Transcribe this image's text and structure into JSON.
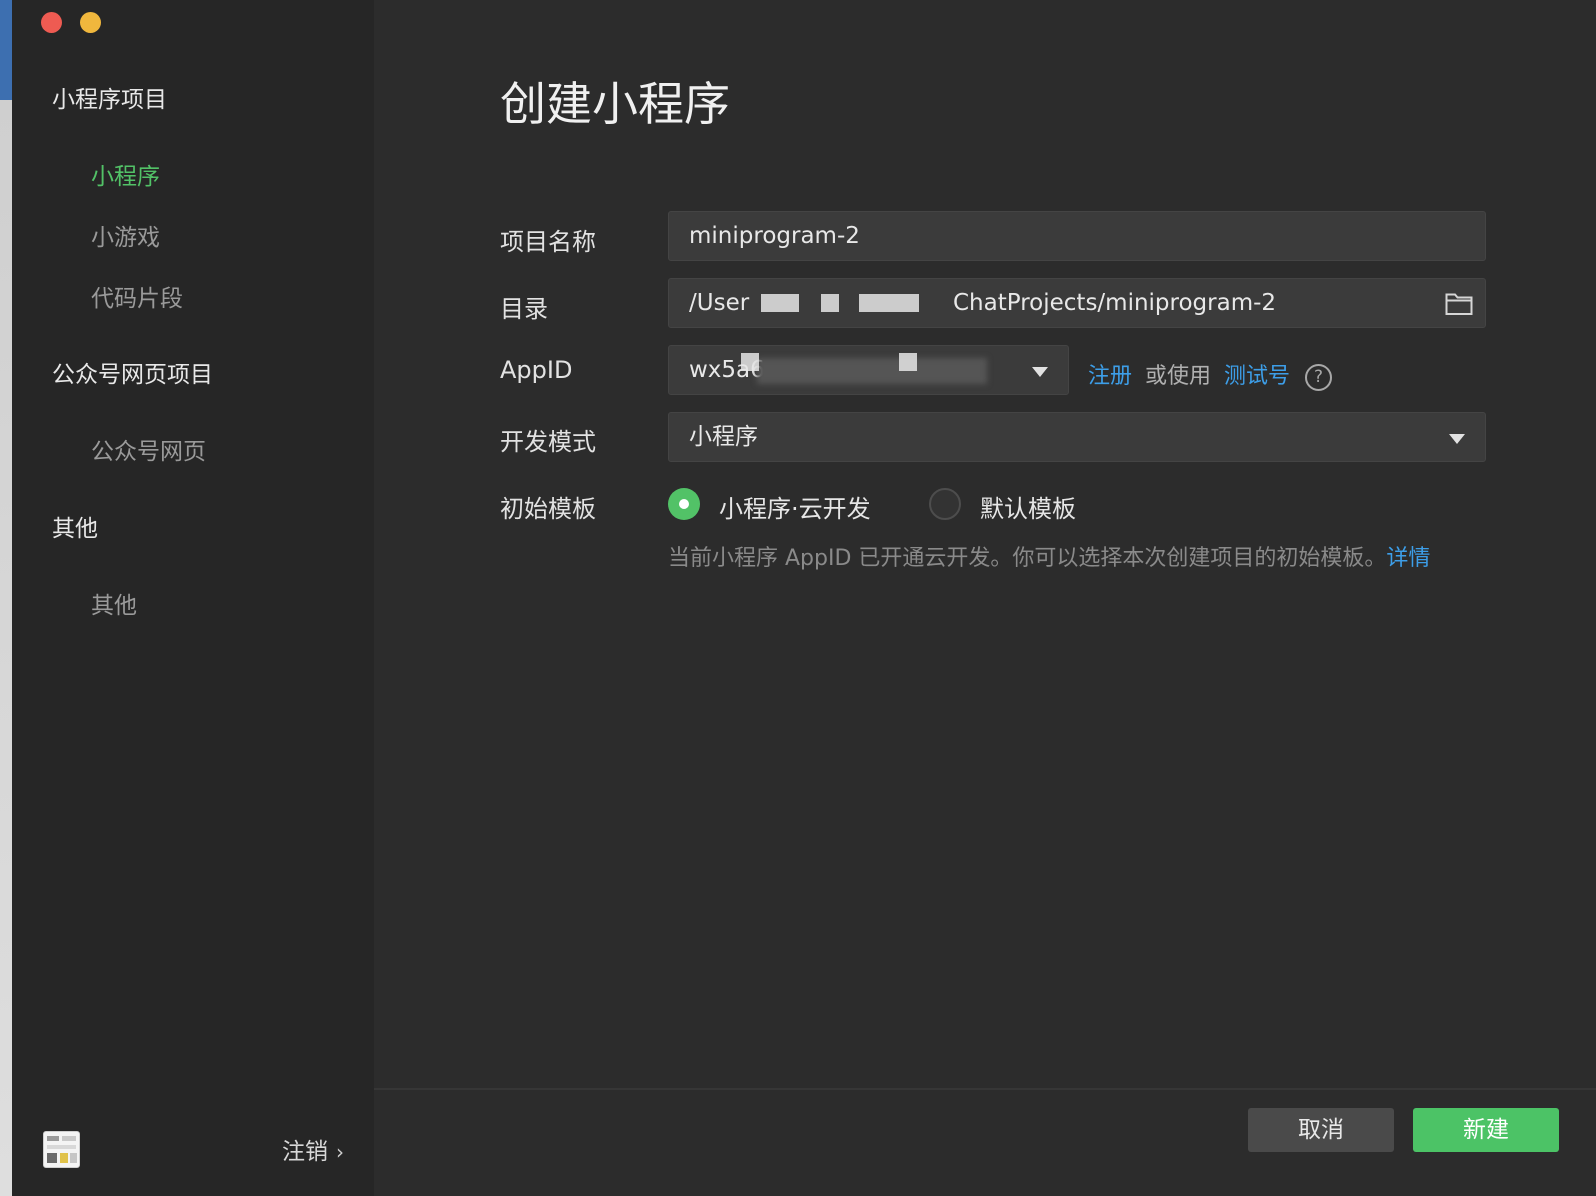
{
  "sidebar": {
    "groups": [
      {
        "title": "小程序项目",
        "items": [
          "小程序",
          "小游戏",
          "代码片段"
        ]
      },
      {
        "title": "公众号网页项目",
        "items": [
          "公众号网页"
        ]
      },
      {
        "title": "其他",
        "items": [
          "其他"
        ]
      }
    ],
    "active_item": "小程序",
    "logout_label": "注销",
    "logout_chevron": "›"
  },
  "main": {
    "title": "创建小程序",
    "fields": {
      "project_name_label": "项目名称",
      "project_name_value": "miniprogram-2",
      "directory_label": "目录",
      "directory_value_start": "/User",
      "directory_value_end": "ChatProjects/miniprogram-2",
      "appid_label": "AppID",
      "appid_value": "wx5a6",
      "mode_label": "开发模式",
      "mode_value": "小程序",
      "template_label": "初始模板"
    },
    "appid_links": {
      "register": "注册",
      "or_use": "或使用",
      "test_account": "测试号",
      "help_glyph": "?"
    },
    "templates": {
      "options": [
        "小程序·云开发",
        "默认模板"
      ],
      "selected": "小程序·云开发"
    },
    "hint": {
      "text": "当前小程序 AppID 已开通云开发。你可以选择本次创建项目的初始模板。",
      "link": "详情"
    },
    "buttons": {
      "cancel": "取消",
      "create": "新建"
    }
  },
  "colors": {
    "accent_green": "#52c267",
    "link_blue": "#3d9ee8",
    "background": "#2c2c2c",
    "sidebar": "#262626"
  },
  "icons": [
    "close-dot-icon",
    "minimize-dot-icon",
    "folder-icon",
    "dropdown-caret-icon",
    "help-icon",
    "chevron-right-icon",
    "avatar"
  ]
}
